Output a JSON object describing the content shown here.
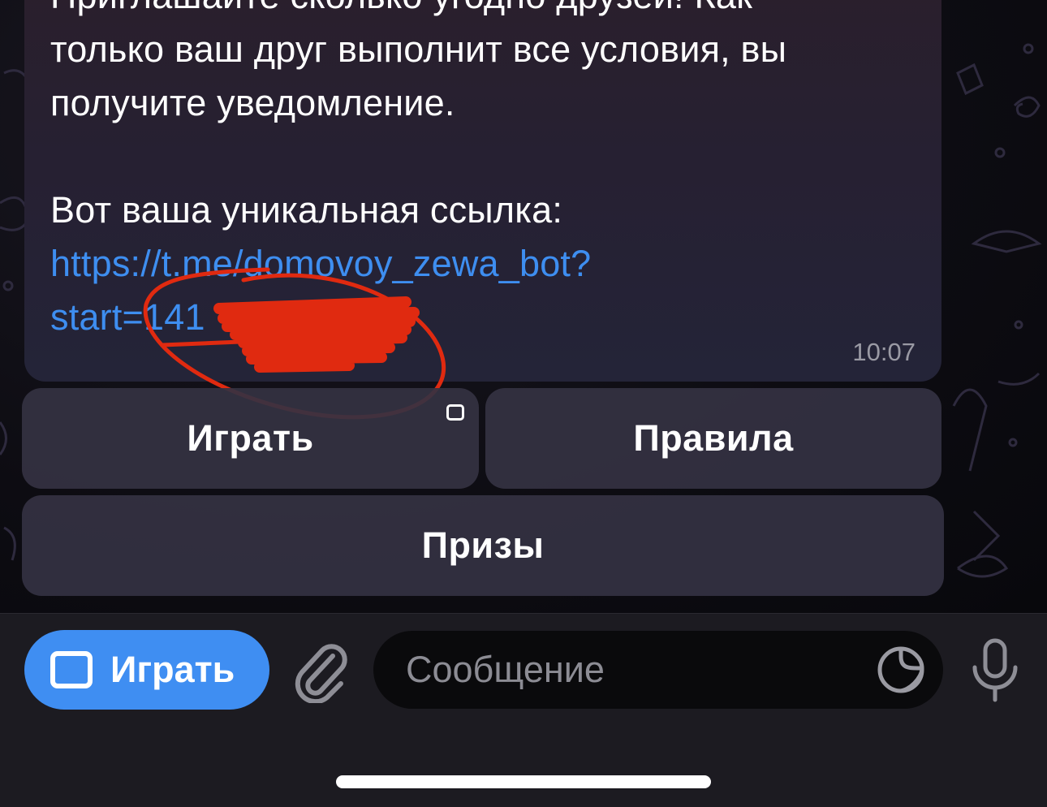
{
  "message": {
    "lines": [
      "Приглашайте сколько угодно друзей! Как",
      "только ваш друг выполнит все условия, вы",
      "получите уведомление.",
      "",
      "Вот ваша уникальная ссылка:"
    ],
    "link_line_1": "https://t.me/domovoy_zewa_bot?",
    "link_line_2": "start=141",
    "time": "10:07"
  },
  "inline_keyboard": {
    "play_label": "Играть",
    "rules_label": "Правила",
    "prizes_label": "Призы"
  },
  "input_bar": {
    "menu_button_label": "Играть",
    "message_placeholder": "Сообщение"
  },
  "icons": {
    "menu_button": "app-window-icon",
    "attach": "paperclip-icon",
    "sticker": "sticker-icon",
    "mic": "microphone-icon",
    "webapp_badge": "web-app-icon"
  },
  "colors": {
    "link": "#3e8ef0",
    "menu_button_bg": "#3f8ef2",
    "annotation_scribble": "#e02a10"
  }
}
